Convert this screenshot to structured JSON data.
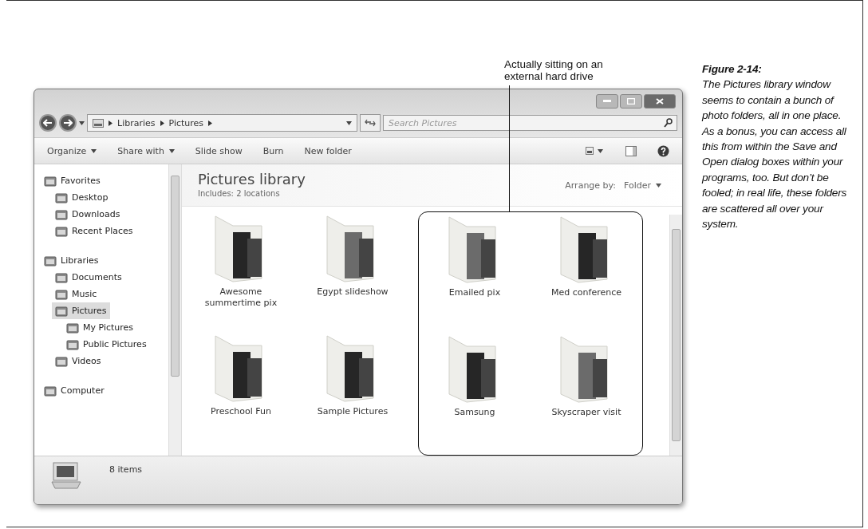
{
  "callout": {
    "text": "Actually sitting on an external hard drive"
  },
  "caption": {
    "title": "Figure 2-14:",
    "body": "The Pictures library window seems to contain a bunch of photo folders, all in one place. As a bonus, you can access all this from within the Save and Open dialog boxes within your programs, too. But don’t be fooled; in real life, these folders are scattered all over your system."
  },
  "address": {
    "crumbs": [
      "Libraries",
      "Pictures"
    ]
  },
  "search": {
    "placeholder": "Search Pictures"
  },
  "toolbar": [
    {
      "label": "Organize",
      "menu": true
    },
    {
      "label": "Share with",
      "menu": true
    },
    {
      "label": "Slide show",
      "menu": false
    },
    {
      "label": "Burn",
      "menu": false
    },
    {
      "label": "New folder",
      "menu": false
    }
  ],
  "sidebar": {
    "items": [
      {
        "label": "Favorites",
        "selected": false,
        "children": [
          {
            "label": "Desktop",
            "selected": false
          },
          {
            "label": "Downloads",
            "selected": false
          },
          {
            "label": "Recent Places",
            "selected": false
          }
        ]
      },
      {
        "label": "Libraries",
        "selected": false,
        "children": [
          {
            "label": "Documents",
            "selected": false
          },
          {
            "label": "Music",
            "selected": false
          },
          {
            "label": "Pictures",
            "selected": true,
            "children": [
              {
                "label": "My Pictures",
                "selected": false
              },
              {
                "label": "Public Pictures",
                "selected": false
              }
            ]
          },
          {
            "label": "Videos",
            "selected": false
          }
        ]
      },
      {
        "label": "Computer",
        "selected": false
      }
    ]
  },
  "library": {
    "title": "Pictures library",
    "includes_label": "Includes:",
    "includes_value": "2 locations",
    "arrange_label": "Arrange by:",
    "arrange_value": "Folder"
  },
  "folders": [
    {
      "name": "Awesome summertime pix"
    },
    {
      "name": "Egypt slideshow"
    },
    {
      "name": "Preschool Fun"
    },
    {
      "name": "Sample Pictures"
    }
  ],
  "highlighted_folders": [
    {
      "name": "Emailed pix"
    },
    {
      "name": "Med conference"
    },
    {
      "name": "Samsung"
    },
    {
      "name": "Skyscraper visit"
    }
  ],
  "status_bar": {
    "text": "8 items"
  }
}
